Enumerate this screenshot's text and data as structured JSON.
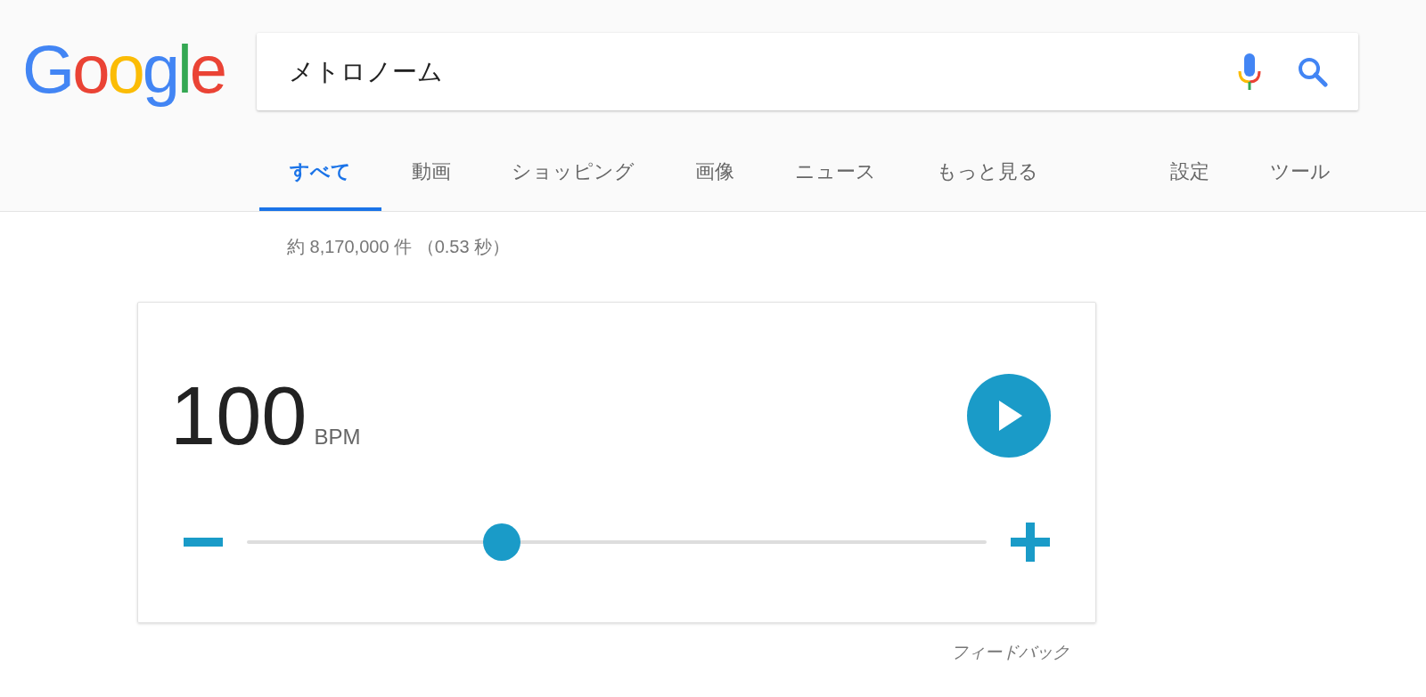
{
  "logo": "Google",
  "search": {
    "value": "メトロノーム"
  },
  "tabs": [
    {
      "label": "すべて",
      "selected": true
    },
    {
      "label": "動画",
      "selected": false
    },
    {
      "label": "ショッピング",
      "selected": false
    },
    {
      "label": "画像",
      "selected": false
    },
    {
      "label": "ニュース",
      "selected": false
    },
    {
      "label": "もっと見る",
      "selected": false
    }
  ],
  "tools": [
    "設定",
    "ツール"
  ],
  "result_stats": "約 8,170,000 件 （0.53 秒）",
  "metronome": {
    "tempo": "100",
    "unit": "BPM",
    "slider": {
      "level": 0.345
    }
  },
  "feedback": "フィードバック"
}
